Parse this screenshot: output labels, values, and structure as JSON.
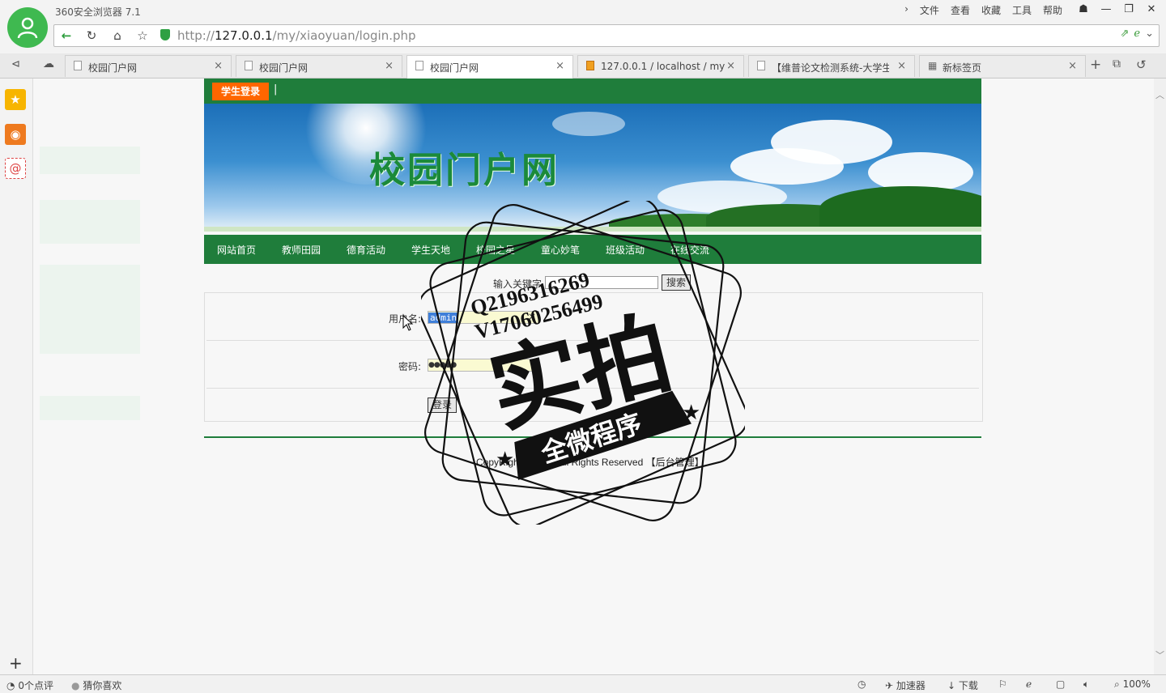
{
  "browser": {
    "app_title": "360安全浏览器 7.1",
    "menu": [
      "文件",
      "查看",
      "收藏",
      "工具",
      "帮助"
    ],
    "url_prefix": "http://",
    "url_host": "127.0.0.1",
    "url_path": "/my/xiaoyuan/login.php"
  },
  "tabs": [
    {
      "label": "校园门户网"
    },
    {
      "label": "校园门户网"
    },
    {
      "label": "校园门户网"
    },
    {
      "label": "127.0.0.1 / localhost / my"
    },
    {
      "label": "【维普论文检测系统-大学生"
    },
    {
      "label": "新标签页"
    }
  ],
  "site": {
    "login_tag": "学生登录",
    "separator": "|",
    "title": "校园门户网",
    "nav": [
      "网站首页",
      "教师田园",
      "德育活动",
      "学生天地",
      "校园之星",
      "童心妙笔",
      "班级活动",
      "在线交流"
    ],
    "search_label": "输入关键字",
    "search_button": "搜索",
    "form": {
      "username_label": "用户名:",
      "username_value": "admin",
      "password_label": "密码:",
      "password_value": "●●●●●",
      "login_button": "登录"
    },
    "copyright": "CopyRight © 2023 All Rights Reserved 【后台管理】"
  },
  "watermark": {
    "contact_q": "Q2196316269",
    "contact_v": "V17060256499",
    "big_text": "实拍",
    "banner_text": "全微程序"
  },
  "status": {
    "comments": "0个点评",
    "guess": "猜你喜欢",
    "accelerator": "加速器",
    "download": "下载",
    "zoom": "100%"
  },
  "colors": {
    "site_green": "#1f7d3b",
    "login_orange": "#ff6600",
    "browser_green": "#3fb950"
  }
}
